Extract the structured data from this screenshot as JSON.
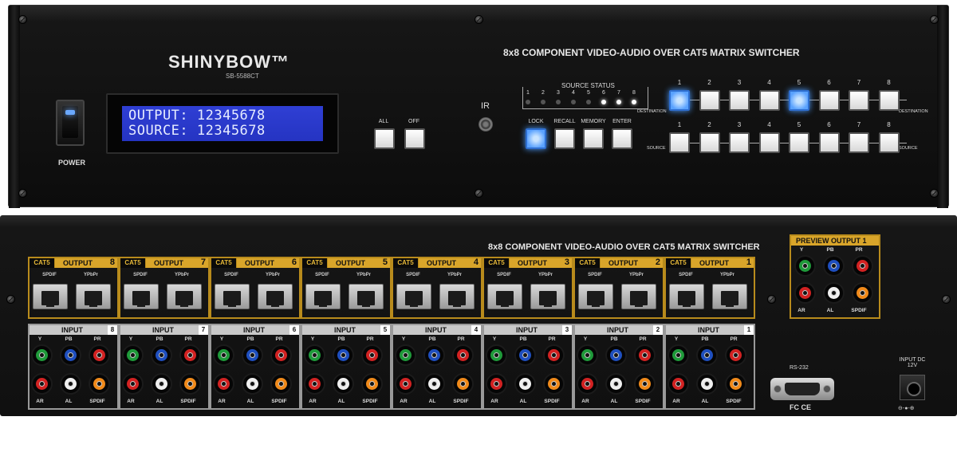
{
  "front": {
    "brand": "SHINYBOW™",
    "model": "SB-5588CT",
    "title": "8x8 COMPONENT VIDEO-AUDIO OVER CAT5 MATRIX SWITCHER",
    "power_label": "POWER",
    "lcd_line1": "OUTPUT: 12345678",
    "lcd_line2": "SOURCE: 12345678",
    "all_label": "ALL",
    "off_label": "OFF",
    "ir_label": "IR",
    "status_title": "SOURCE STATUS",
    "status_leds": [
      {
        "num": "1",
        "on": false
      },
      {
        "num": "2",
        "on": false
      },
      {
        "num": "3",
        "on": false
      },
      {
        "num": "4",
        "on": false
      },
      {
        "num": "5",
        "on": false
      },
      {
        "num": "6",
        "on": true
      },
      {
        "num": "7",
        "on": true
      },
      {
        "num": "8",
        "on": true
      }
    ],
    "control_buttons": [
      {
        "label": "LOCK",
        "lit": true
      },
      {
        "label": "RECALL",
        "lit": false
      },
      {
        "label": "MEMORY",
        "lit": false
      },
      {
        "label": "ENTER",
        "lit": false
      }
    ],
    "destination_label": "DESTINATION",
    "source_label": "SOURCE",
    "destination_buttons": [
      {
        "num": "1",
        "lit": true
      },
      {
        "num": "2",
        "lit": false
      },
      {
        "num": "3",
        "lit": false
      },
      {
        "num": "4",
        "lit": false
      },
      {
        "num": "5",
        "lit": true
      },
      {
        "num": "6",
        "lit": false
      },
      {
        "num": "7",
        "lit": false
      },
      {
        "num": "8",
        "lit": false
      }
    ],
    "source_buttons": [
      {
        "num": "1",
        "lit": false
      },
      {
        "num": "2",
        "lit": false
      },
      {
        "num": "3",
        "lit": false
      },
      {
        "num": "4",
        "lit": false
      },
      {
        "num": "5",
        "lit": false
      },
      {
        "num": "6",
        "lit": false
      },
      {
        "num": "7",
        "lit": false
      },
      {
        "num": "8",
        "lit": false
      }
    ]
  },
  "rear": {
    "title": "8x8 COMPONENT VIDEO-AUDIO OVER CAT5 MATRIX SWITCHER",
    "cat5_tag": "CAT5",
    "output_label": "OUTPUT",
    "input_label": "INPUT",
    "spdif_label": "SPDIF",
    "ypbpr_label": "YPbPr",
    "output_numbers": [
      "8",
      "7",
      "6",
      "5",
      "4",
      "3",
      "2",
      "1"
    ],
    "input_numbers": [
      "8",
      "7",
      "6",
      "5",
      "4",
      "3",
      "2",
      "1"
    ],
    "input_top_labels": [
      "Y",
      "PB",
      "PR"
    ],
    "input_bottom_labels": [
      "AR",
      "AL",
      "SPDIF"
    ],
    "preview_title": "PREVIEW OUTPUT 1",
    "preview_top_labels": [
      "Y",
      "PB",
      "PR"
    ],
    "preview_bottom_labels": [
      "AR",
      "AL",
      "SPDIF"
    ],
    "rs232_label": "RS-232",
    "cert_label": "FC CE",
    "dc_label": "INPUT DC 12V",
    "dc_polarity": "⊖-●-⊕"
  },
  "colors": {
    "y": "#1f9a3a",
    "pb": "#1f4fbf",
    "pr": "#d22222",
    "ar": "#d22222",
    "al": "#f0f0f0",
    "spdif": "#f08a1a",
    "gold": "#d9a52a",
    "lcd": "#2f3fd4",
    "button_lit": "#5aa2ff"
  }
}
